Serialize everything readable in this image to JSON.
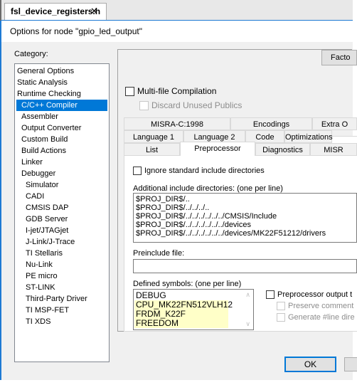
{
  "editor_tab": {
    "filename": "fsl_device_registers.h",
    "close_glyph": "✕"
  },
  "dialog": {
    "title": "Options for node \"gpio_led_output\"",
    "category_label": "Category:",
    "categories": [
      {
        "label": "General Options",
        "indent": 0,
        "selected": false
      },
      {
        "label": "Static Analysis",
        "indent": 0,
        "selected": false
      },
      {
        "label": "Runtime Checking",
        "indent": 0,
        "selected": false
      },
      {
        "label": "C/C++ Compiler",
        "indent": 1,
        "selected": true
      },
      {
        "label": "Assembler",
        "indent": 1,
        "selected": false
      },
      {
        "label": "Output Converter",
        "indent": 1,
        "selected": false
      },
      {
        "label": "Custom Build",
        "indent": 1,
        "selected": false
      },
      {
        "label": "Build Actions",
        "indent": 1,
        "selected": false
      },
      {
        "label": "Linker",
        "indent": 1,
        "selected": false
      },
      {
        "label": "Debugger",
        "indent": 1,
        "selected": false
      },
      {
        "label": "Simulator",
        "indent": 2,
        "selected": false
      },
      {
        "label": "CADI",
        "indent": 2,
        "selected": false
      },
      {
        "label": "CMSIS DAP",
        "indent": 2,
        "selected": false
      },
      {
        "label": "GDB Server",
        "indent": 2,
        "selected": false
      },
      {
        "label": "I-jet/JTAGjet",
        "indent": 2,
        "selected": false
      },
      {
        "label": "J-Link/J-Trace",
        "indent": 2,
        "selected": false
      },
      {
        "label": "TI Stellaris",
        "indent": 2,
        "selected": false
      },
      {
        "label": "Nu-Link",
        "indent": 2,
        "selected": false
      },
      {
        "label": "PE micro",
        "indent": 2,
        "selected": false
      },
      {
        "label": "ST-LINK",
        "indent": 2,
        "selected": false
      },
      {
        "label": "Third-Party Driver",
        "indent": 2,
        "selected": false
      },
      {
        "label": "TI MSP-FET",
        "indent": 2,
        "selected": false
      },
      {
        "label": "TI XDS",
        "indent": 2,
        "selected": false
      }
    ],
    "factory_button": "Facto",
    "multi_file": {
      "label": "Multi-file Compilation",
      "checked": false
    },
    "discard_unused": {
      "label": "Discard Unused Publics",
      "checked": false,
      "disabled": true
    },
    "tab_rows": [
      [
        "MISRA-C:1998",
        "Encodings",
        "Extra O"
      ],
      [
        "Language 1",
        "Language 2",
        "Code",
        "Optimizations"
      ],
      [
        "List",
        "Preprocessor",
        "Diagnostics",
        "MISR"
      ]
    ],
    "active_tab": "Preprocessor",
    "ignore_std": {
      "label": "Ignore standard include directories",
      "checked": false
    },
    "include_dirs_label": "Additional include directories: (one per line)",
    "include_dirs": [
      "$PROJ_DIR$/..",
      "$PROJ_DIR$/../../../..",
      "$PROJ_DIR$/../../../../../../CMSIS/Include",
      "$PROJ_DIR$/../../../../../../devices",
      "$PROJ_DIR$/../../../../../../devices/MK22F51212/drivers"
    ],
    "preinclude_label": "Preinclude file:",
    "preinclude_value": "",
    "defined_symbols_label": "Defined symbols: (one per line)",
    "defined_symbols": [
      {
        "text": "DEBUG",
        "highlighted": false
      },
      {
        "text": "CPU_MK22FN512VLH12",
        "highlighted": true
      },
      {
        "text": "FRDM_K22F",
        "highlighted": true
      },
      {
        "text": "FREEDOM",
        "highlighted": true
      }
    ],
    "pp_output": {
      "label": "Preprocessor output t",
      "checked": false
    },
    "preserve_comments": {
      "label": "Preserve comment",
      "checked": false,
      "disabled": true
    },
    "generate_line": {
      "label": "Generate #line dire",
      "checked": false,
      "disabled": true
    },
    "ok_button": "OK"
  },
  "colors": {
    "accent": "#0078d7",
    "highlight": "#ffffc8"
  }
}
